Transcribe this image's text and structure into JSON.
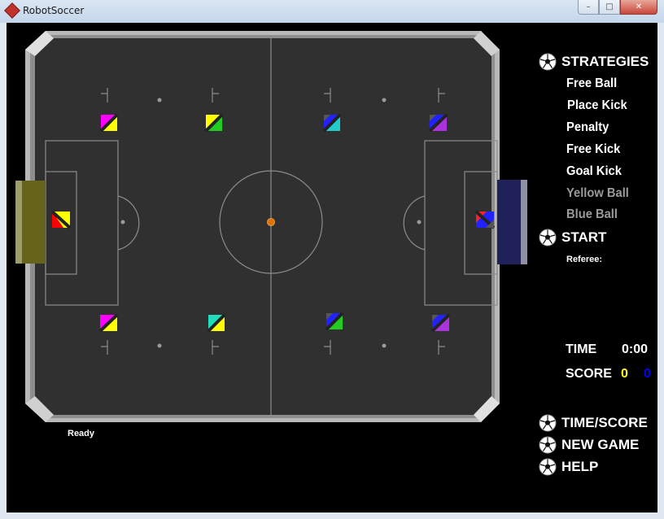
{
  "window": {
    "title": "RobotSoccer",
    "min": "–",
    "max": "□",
    "close": "✕"
  },
  "menu": {
    "strategies_label": "STRATEGIES",
    "items": [
      "Free  Ball",
      "Place Kick",
      "Penalty",
      "Free Kick",
      "Goal Kick",
      "Yellow Ball",
      "Blue Ball"
    ],
    "disabled_items": [
      "Yellow Ball",
      "Blue Ball"
    ],
    "start_label": "START",
    "referee_label": "Referee:"
  },
  "stats": {
    "time_label": "TIME",
    "time_value": "0:00",
    "score_label": "SCORE",
    "score_yellow": "0",
    "score_blue": "0"
  },
  "buttons": {
    "time_score": "TIME/SCORE",
    "new_game": "NEW GAME",
    "help": "HELP"
  },
  "status": {
    "text": "Ready"
  },
  "colors": {
    "pitch": "#303030",
    "border": "#a9a9a9",
    "yellow_goal": "#66641a",
    "blue_goal": "#20205a",
    "ball": "#e07000",
    "score_yellow": "#ffff00",
    "score_blue": "#0000ff"
  }
}
